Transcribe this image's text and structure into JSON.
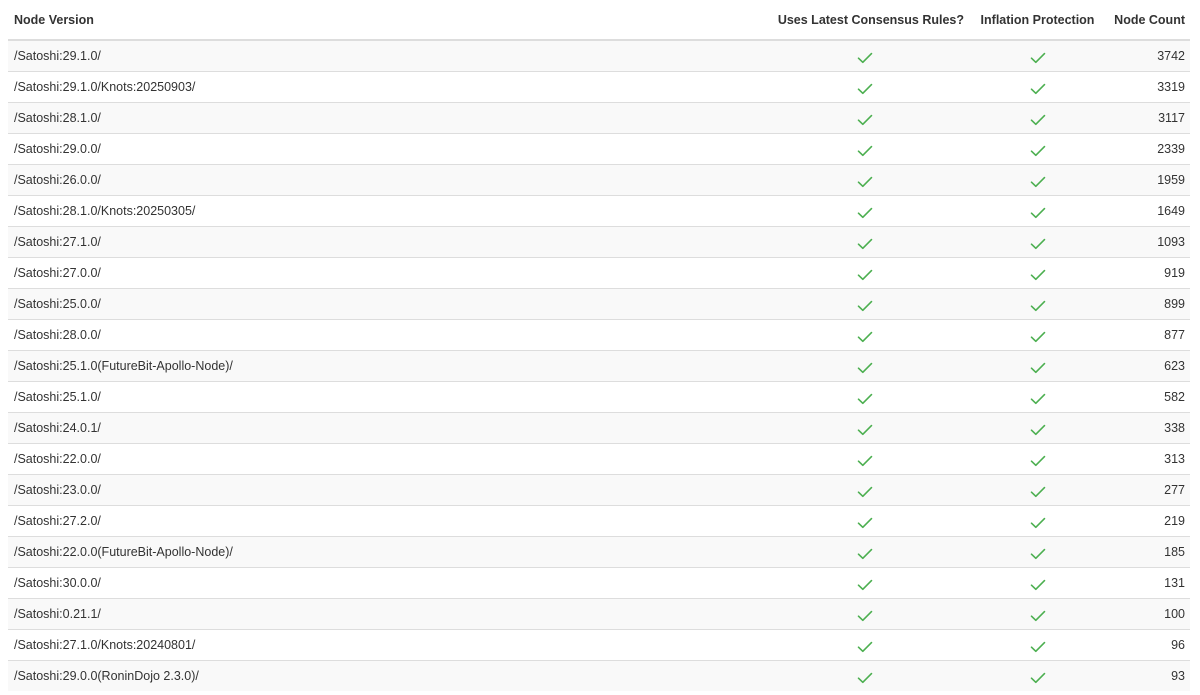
{
  "table": {
    "headers": {
      "version": "Node Version",
      "consensus": "Uses Latest Consensus Rules?",
      "inflation": "Inflation Protection",
      "count": "Node Count"
    },
    "check_icon": "check-icon",
    "check_color": "#4caf50",
    "rows": [
      {
        "version": "/Satoshi:29.1.0/",
        "consensus": true,
        "inflation": true,
        "count": "3742"
      },
      {
        "version": "/Satoshi:29.1.0/Knots:20250903/",
        "consensus": true,
        "inflation": true,
        "count": "3319"
      },
      {
        "version": "/Satoshi:28.1.0/",
        "consensus": true,
        "inflation": true,
        "count": "3117"
      },
      {
        "version": "/Satoshi:29.0.0/",
        "consensus": true,
        "inflation": true,
        "count": "2339"
      },
      {
        "version": "/Satoshi:26.0.0/",
        "consensus": true,
        "inflation": true,
        "count": "1959"
      },
      {
        "version": "/Satoshi:28.1.0/Knots:20250305/",
        "consensus": true,
        "inflation": true,
        "count": "1649"
      },
      {
        "version": "/Satoshi:27.1.0/",
        "consensus": true,
        "inflation": true,
        "count": "1093"
      },
      {
        "version": "/Satoshi:27.0.0/",
        "consensus": true,
        "inflation": true,
        "count": "919"
      },
      {
        "version": "/Satoshi:25.0.0/",
        "consensus": true,
        "inflation": true,
        "count": "899"
      },
      {
        "version": "/Satoshi:28.0.0/",
        "consensus": true,
        "inflation": true,
        "count": "877"
      },
      {
        "version": "/Satoshi:25.1.0(FutureBit-Apollo-Node)/",
        "consensus": true,
        "inflation": true,
        "count": "623"
      },
      {
        "version": "/Satoshi:25.1.0/",
        "consensus": true,
        "inflation": true,
        "count": "582"
      },
      {
        "version": "/Satoshi:24.0.1/",
        "consensus": true,
        "inflation": true,
        "count": "338"
      },
      {
        "version": "/Satoshi:22.0.0/",
        "consensus": true,
        "inflation": true,
        "count": "313"
      },
      {
        "version": "/Satoshi:23.0.0/",
        "consensus": true,
        "inflation": true,
        "count": "277"
      },
      {
        "version": "/Satoshi:27.2.0/",
        "consensus": true,
        "inflation": true,
        "count": "219"
      },
      {
        "version": "/Satoshi:22.0.0(FutureBit-Apollo-Node)/",
        "consensus": true,
        "inflation": true,
        "count": "185"
      },
      {
        "version": "/Satoshi:30.0.0/",
        "consensus": true,
        "inflation": true,
        "count": "131"
      },
      {
        "version": "/Satoshi:0.21.1/",
        "consensus": true,
        "inflation": true,
        "count": "100"
      },
      {
        "version": "/Satoshi:27.1.0/Knots:20240801/",
        "consensus": true,
        "inflation": true,
        "count": "96"
      },
      {
        "version": "/Satoshi:29.0.0(RoninDojo 2.3.0)/",
        "consensus": true,
        "inflation": true,
        "count": "93"
      }
    ]
  }
}
